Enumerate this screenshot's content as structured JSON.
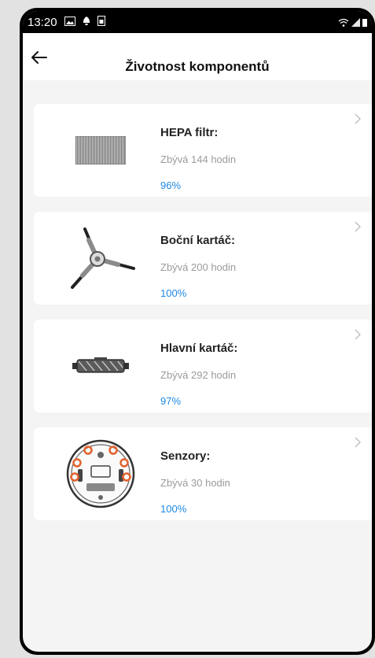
{
  "status_bar": {
    "time": "13:20",
    "icons": [
      "image-icon",
      "notification-icon",
      "sim-icon"
    ],
    "right_icons": [
      "wifi-icon",
      "signal-icon",
      "battery-icon"
    ]
  },
  "header": {
    "title": "Životnost komponentů",
    "back_icon": "arrow-left-icon"
  },
  "components": [
    {
      "name": "HEPA filtr:",
      "remaining": "Zbývá 144 hodin",
      "percent": "96%",
      "icon": "hepa-filter-icon"
    },
    {
      "name": "Boční kartáč:",
      "remaining": "Zbývá 200 hodin",
      "percent": "100%",
      "icon": "side-brush-icon"
    },
    {
      "name": "Hlavní kartáč:",
      "remaining": "Zbývá 292 hodin",
      "percent": "97%",
      "icon": "main-brush-icon"
    },
    {
      "name": "Senzory:",
      "remaining": "Zbývá 30 hodin",
      "percent": "100%",
      "icon": "sensors-icon"
    }
  ],
  "colors": {
    "accent": "#1e88e5",
    "card": "#ffffff",
    "background": "#f4f4f4"
  }
}
